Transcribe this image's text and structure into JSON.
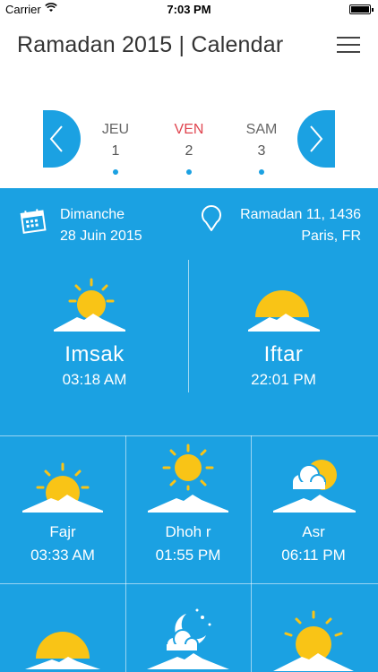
{
  "status_bar": {
    "carrier": "Carrier",
    "time": "7:03 PM"
  },
  "header": {
    "title": "Ramadan 2015 | Calendar"
  },
  "days": [
    {
      "name": "JEU",
      "number": "1"
    },
    {
      "name": "VEN",
      "number": "2"
    },
    {
      "name": "SAM",
      "number": "3"
    }
  ],
  "info": {
    "weekday": "Dimanche",
    "date": "28 Juin 2015",
    "hijri": "Ramadan 11, 1436",
    "location": "Paris, FR"
  },
  "main_times": [
    {
      "label": "Imsak",
      "time": "03:18 AM",
      "icon": "sun-mountain-icon"
    },
    {
      "label": "Iftar",
      "time": "22:01 PM",
      "icon": "sunset-mountain-icon"
    }
  ],
  "prayers": [
    {
      "label": "Fajr",
      "time": "03:33 AM",
      "icon": "sunrise-mountain-icon"
    },
    {
      "label": "Dhoh r",
      "time": "01:55 PM",
      "icon": "sun-high-mountain-icon"
    },
    {
      "label": "Asr",
      "time": "06:11 PM",
      "icon": "sun-cloud-mountain-icon"
    }
  ],
  "colors": {
    "accent": "#1ba1e2",
    "sun": "#f9c416",
    "active_day": "#e0454f"
  }
}
